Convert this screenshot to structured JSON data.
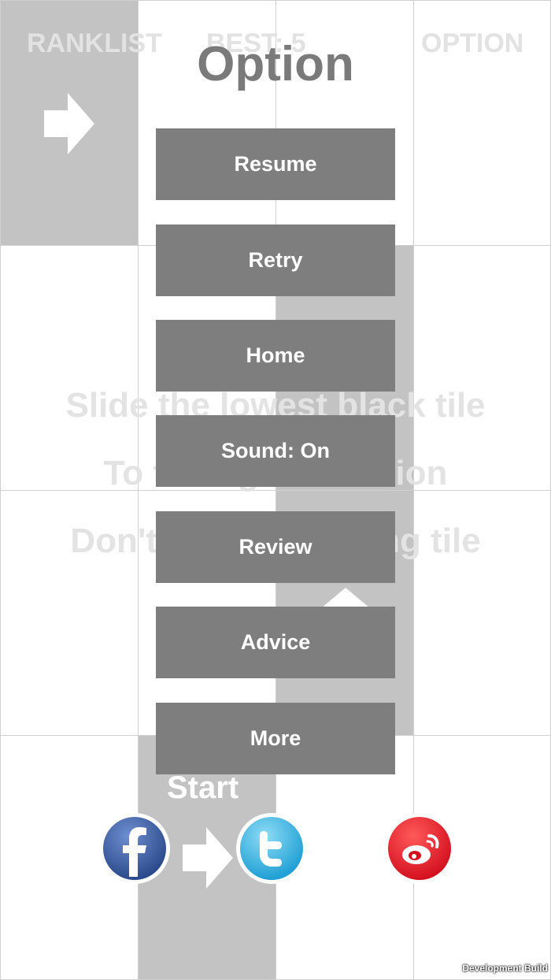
{
  "header": {
    "ranklist_label": "RANKLIST",
    "best_label": "BEST: 5",
    "option_label": "OPTION"
  },
  "background": {
    "instruction_line1": "Slide the lowest black tile",
    "instruction_line2": "To the right direction",
    "instruction_line3": "Don't slide the wrong tile"
  },
  "dialog": {
    "title": "Option",
    "buttons": [
      {
        "label": "Resume"
      },
      {
        "label": "Retry"
      },
      {
        "label": "Home"
      },
      {
        "label": "Sound: On"
      },
      {
        "label": "Review"
      },
      {
        "label": "Advice"
      },
      {
        "label": "More"
      }
    ]
  },
  "start": {
    "label": "Start"
  },
  "social": {
    "facebook_color": "#3b5998",
    "twitter_color": "#33b6e8",
    "weibo_color": "#e6162d"
  },
  "footer": {
    "build_label": "Development Build"
  },
  "colors": {
    "tile_gray": "#c3c3c3",
    "button_gray": "#7e7e7e",
    "grid_line": "#d0d0d0"
  }
}
